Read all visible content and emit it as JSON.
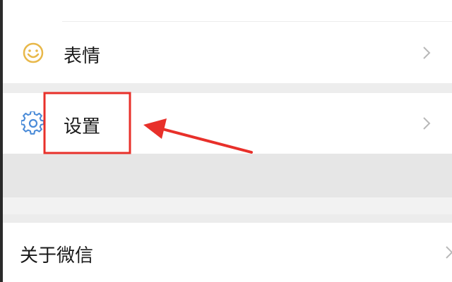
{
  "menu": {
    "top_partial_item": {
      "icon": "wallet-icon"
    },
    "emoji": {
      "label": "表情",
      "icon": "smiley-icon"
    },
    "settings": {
      "label": "设置",
      "icon": "gear-icon"
    },
    "about": {
      "label": "关于微信"
    }
  },
  "annotation": {
    "box_color": "#e8302a",
    "arrow_color": "#e8302a"
  },
  "colors": {
    "icon_yellow": "#e8b84a",
    "icon_blue": "#4a8bd8",
    "chevron": "#b8b8b8"
  }
}
